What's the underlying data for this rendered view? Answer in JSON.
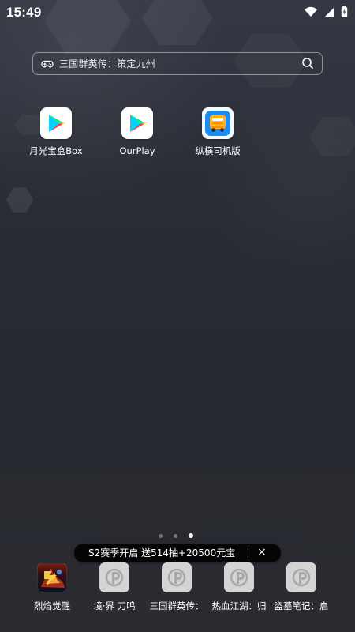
{
  "status_bar": {
    "time": "15:49",
    "icons": [
      "wifi-icon",
      "signal-icon",
      "battery-icon"
    ]
  },
  "search": {
    "text": "三国群英传：策定九州",
    "icons": [
      "gamepad-icon",
      "search-icon"
    ]
  },
  "apps": [
    {
      "label": "月光宝盒Box",
      "icon": "play-store-icon"
    },
    {
      "label": "OurPlay",
      "icon": "play-store-icon"
    },
    {
      "label": "纵横司机版",
      "icon": "bus-icon"
    }
  ],
  "page_indicator": {
    "current_page": 3,
    "total_pages": 3
  },
  "promo": {
    "text": "S2赛季开启 送514抽+20500元宝",
    "close_label": "×"
  },
  "dock": [
    {
      "label": "烈焰觉醒",
      "icon": "game-art-icon"
    },
    {
      "label": "境·界 刀鸣",
      "icon": "placeholder-app-icon"
    },
    {
      "label": "三国群英传：",
      "icon": "placeholder-app-icon"
    },
    {
      "label": "热血江湖：归",
      "icon": "placeholder-app-icon"
    },
    {
      "label": "盗墓笔记：启",
      "icon": "placeholder-app-icon"
    }
  ],
  "colors": {
    "background_top": "#353844",
    "background_bottom": "#2a2c31",
    "banner_bg": "#050505",
    "placeholder_tile": "#d4d4d4"
  }
}
